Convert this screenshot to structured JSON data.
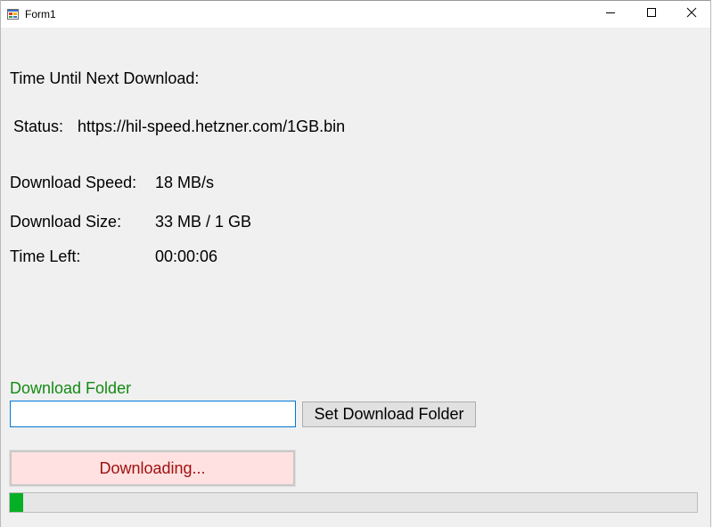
{
  "window": {
    "title": "Form1",
    "controls": {
      "minimize_icon": "minimize-icon",
      "maximize_icon": "maximize-icon",
      "close_icon": "close-icon"
    }
  },
  "labels": {
    "next_download": "Time Until Next Download:",
    "status_label": "Status:",
    "status_value": "https://hil-speed.hetzner.com/1GB.bin",
    "speed_label": "Download Speed:",
    "speed_value": "18 MB/s",
    "size_label": "Download Size:",
    "size_value": "33 MB / 1 GB",
    "time_left_label": "Time Left:",
    "time_left_value": "00:00:06",
    "folder_label": "Download Folder"
  },
  "folder_input": {
    "value": "",
    "placeholder": ""
  },
  "buttons": {
    "set_folder": "Set Download Folder",
    "downloading": "Downloading..."
  },
  "progress": {
    "fraction": 0.02
  },
  "colors": {
    "folder_label": "#138a13",
    "downloading_bg": "#ffe1e1",
    "downloading_text": "#a01010",
    "progress_fill": "#06b025"
  }
}
